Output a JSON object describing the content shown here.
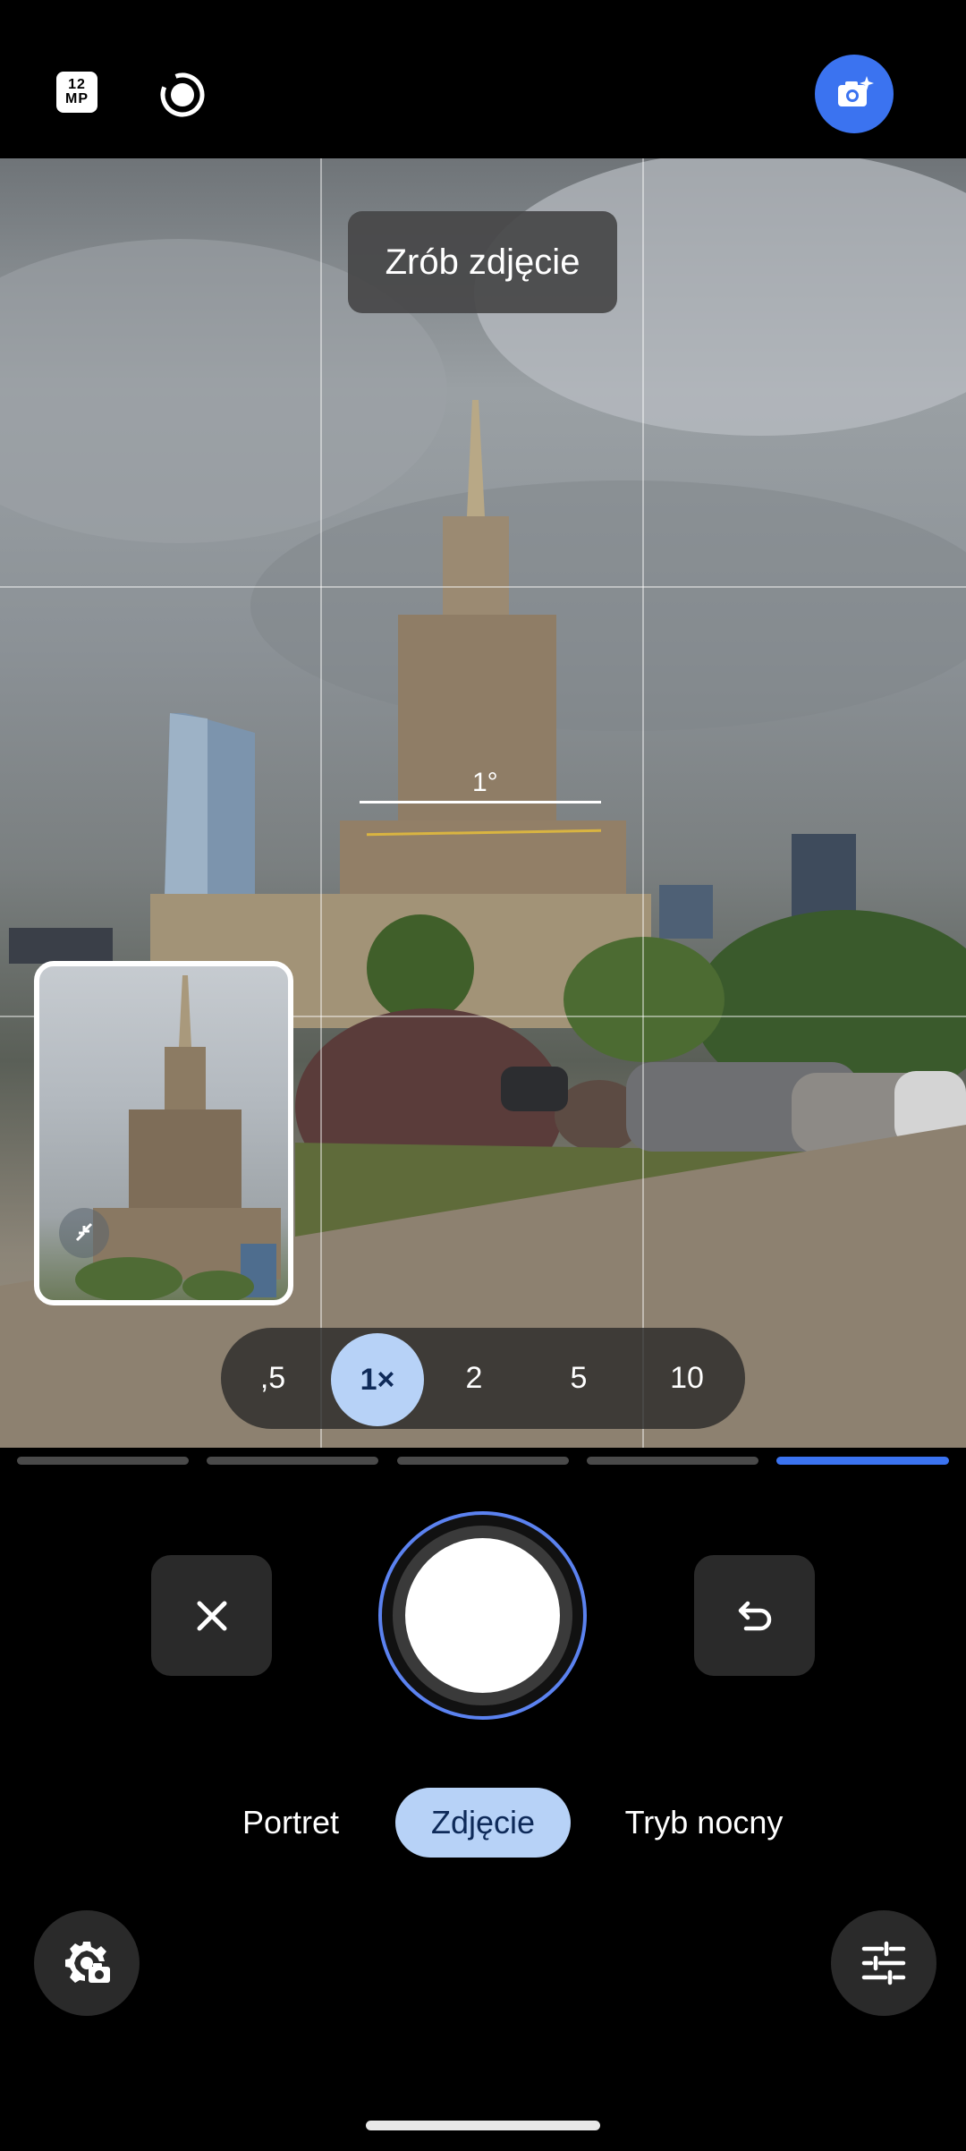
{
  "top_bar": {
    "resolution_badge": {
      "line1": "12",
      "line2": "MP"
    },
    "timer_icon": "timer-icon",
    "ai_camera_icon": "camera-sparkle-icon"
  },
  "viewfinder": {
    "hint_text": "Zrób zdjęcie",
    "level_text": "1°"
  },
  "zoom": {
    "options": [
      ",5",
      "1×",
      "2",
      "5",
      "10"
    ],
    "selected": "1×"
  },
  "mode_indicators": {
    "count": 5,
    "active_index": 4
  },
  "controls": {
    "close_icon": "close-icon",
    "undo_icon": "undo-icon",
    "shutter_icon": "shutter-icon"
  },
  "modes": {
    "items": [
      "Portret",
      "Zdjęcie",
      "Tryb nocny"
    ],
    "selected": "Zdjęcie"
  },
  "bottom": {
    "settings_icon": "settings-camera-icon",
    "adjust_icon": "adjust-sliders-icon"
  },
  "colors": {
    "accent": "#3b73f0",
    "selection": "#b7d2f7",
    "selection_text": "#0e2a59"
  }
}
